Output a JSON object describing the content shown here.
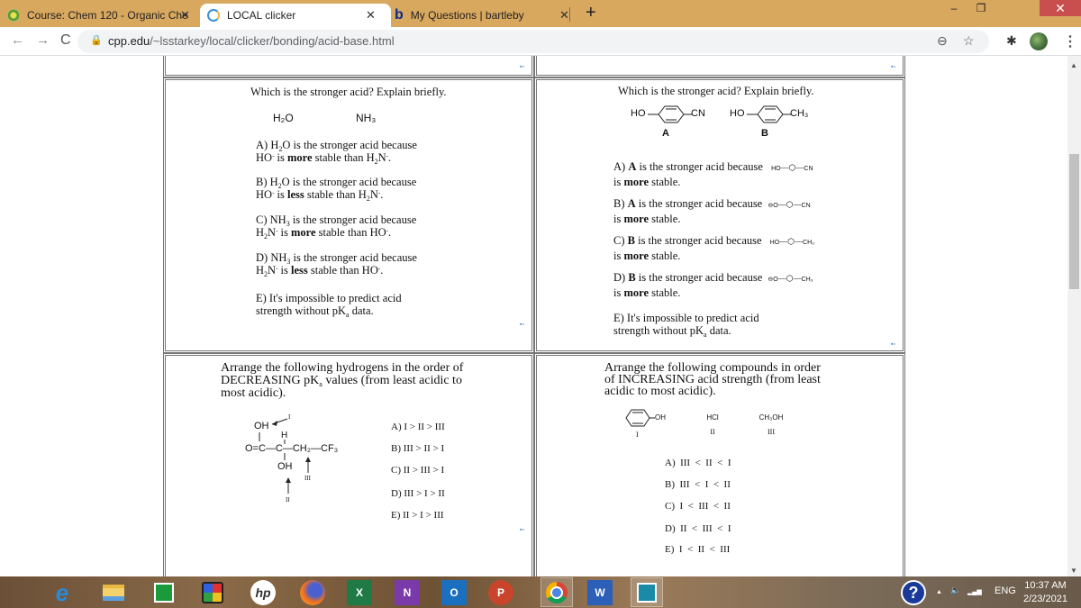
{
  "browser": {
    "tabs": [
      {
        "label": "Course: Chem 120 - Organic Che",
        "active": false
      },
      {
        "label": "LOCAL clicker",
        "active": true
      },
      {
        "label": "My Questions | bartleby",
        "active": false,
        "favicon": "b"
      }
    ],
    "tab_close": "✕",
    "new_tab": "+",
    "window": {
      "minimize": "–",
      "maximize": "❐",
      "close": "✕"
    },
    "nav": {
      "back": "←",
      "forward": "→",
      "reload": "C"
    },
    "url_host": "cpp.edu",
    "url_path": "/~lsstarkey/local/clicker/bonding/acid-base.html",
    "lock": "🔒",
    "icons": {
      "zoom": "⊖",
      "star": "☆",
      "extension": "✱",
      "menu": "⋮"
    }
  },
  "page": {
    "marker": "▪▫",
    "cut_text": "strength without pKa data.",
    "q1": {
      "prompt": "Which is the stronger acid?  Explain briefly.",
      "compounds": [
        "H₂O",
        "NH₃"
      ],
      "options": [
        {
          "pre": "A) H",
          "sub1": "2",
          "mid": "O is the stronger acid because",
          "line2a": "HO",
          "sup2a": "-",
          "line2b": " is ",
          "bold": "more",
          "line2c": " stable than H",
          "sub2": "2",
          "line2d": "N",
          "sup2b": "-",
          "end": "."
        },
        {
          "pre": "B) H",
          "sub1": "2",
          "mid": "O is the stronger acid because",
          "line2a": "HO",
          "sup2a": "-",
          "line2b": " is ",
          "bold": "less",
          "line2c": " stable than H",
          "sub2": "2",
          "line2d": "N",
          "sup2b": "-",
          "end": "."
        },
        {
          "pre": "C) NH",
          "sub1": "3",
          "mid": " is the stronger acid because",
          "line2a": "H",
          "sub2a": "2",
          "line2a2": "N",
          "sup2a": "-",
          "line2b": " is ",
          "bold": "more",
          "line2c": " stable than HO",
          "sup2b": "-",
          "end": "."
        },
        {
          "pre": "D) NH",
          "sub1": "3",
          "mid": " is the stronger acid because",
          "line2a": "H",
          "sub2a": "2",
          "line2a2": "N",
          "sup2a": "-",
          "line2b": " is ",
          "bold": "less",
          "line2c": " stable than HO",
          "sup2b": "-",
          "end": "."
        }
      ],
      "option_e": {
        "line1": "E) It's impossible to predict acid",
        "line2a": "strength without pK",
        "sub": "a",
        "line2b": " data."
      }
    },
    "q2": {
      "prompt": "Which is the stronger acid?  Explain briefly.",
      "mol_a": {
        "left": "HO",
        "right": "CN",
        "label": "A"
      },
      "mol_b": {
        "left": "HO",
        "right": "CH₃",
        "label": "B"
      },
      "options": [
        {
          "letter": "A) ",
          "subject": "A",
          "text": " is the stronger acid because",
          "mol_left": "HO",
          "mol_right": "CN",
          "line2a": "is ",
          "bold": "more",
          "line2b": " stable."
        },
        {
          "letter": "B) ",
          "subject": "A",
          "text": " is the stronger acid because",
          "mol_left": "⊖O",
          "mol_right": "CN",
          "line2a": "is ",
          "bold": "more",
          "line2b": " stable."
        },
        {
          "letter": "C) ",
          "subject": "B",
          "text": " is the stronger acid because",
          "mol_left": "HO",
          "mol_right": "CH₃",
          "line2a": "is ",
          "bold": "more",
          "line2b": " stable."
        },
        {
          "letter": "D) ",
          "subject": "B",
          "text": " is the stronger acid because",
          "mol_left": "⊖O",
          "mol_right": "CH₃",
          "line2a": "is ",
          "bold": "more",
          "line2b": " stable."
        }
      ],
      "option_e": {
        "line1": "E) It's impossible to predict acid",
        "line2a": "strength without pK",
        "sub": "a",
        "line2b": " data."
      }
    },
    "q3": {
      "prompt_l1": "Arrange the following hydrogens in the order of",
      "prompt_l2a": "DECREASING pK",
      "prompt_sub": "a",
      "prompt_l2b": " values (from least acidic to",
      "prompt_l3": "most acidic).",
      "structure": {
        "oh_top": "OH",
        "h_top": "H",
        "chain": "O=C—C—CH₂—CF₃",
        "oh_bottom": "OH",
        "label_i": "I",
        "label_ii": "II",
        "label_iii": "III"
      },
      "options": [
        "A) I > II > III",
        "B) III > II > I",
        "C) II > III > I",
        "D) III > I > II",
        "E) II > I > III"
      ]
    },
    "q4": {
      "prompt_l1": "Arrange the following compounds in order",
      "prompt_l2": "of INCREASING acid strength (from least",
      "prompt_l3": "acidic to most acidic).",
      "compounds": [
        {
          "formula": "OH",
          "label": "I"
        },
        {
          "formula": "HCl",
          "label": "II"
        },
        {
          "formula": "CH₃OH",
          "label": "III"
        }
      ],
      "options": [
        "A)  III  <  II  <  I",
        "B)  III  <  I  <  II",
        "C)  I  <  III  <  II",
        "D)  II  <  III  <  I",
        "E)  I  <  II  <  III"
      ]
    }
  },
  "scrollbar": {
    "up": "▲",
    "down": "▼",
    "position_fraction": 0.22
  },
  "taskbar": {
    "apps": [
      "start",
      "internet-explorer",
      "file-explorer",
      "store",
      "puzzle-app",
      "hp",
      "firefox",
      "excel",
      "onenote",
      "outlook",
      "powerpoint",
      "chrome",
      "word",
      "photos"
    ],
    "labels": {
      "excel": "X",
      "onenote": "N",
      "outlook": "O",
      "powerpoint": "P",
      "word": "W",
      "hp": "hp",
      "ie": "e",
      "help": "?"
    },
    "tray": {
      "chevron": "▲",
      "volume": "🔈",
      "signal": "▂▄▆",
      "lang": "ENG"
    },
    "time": "10:37 AM",
    "date": "2/23/2021"
  }
}
